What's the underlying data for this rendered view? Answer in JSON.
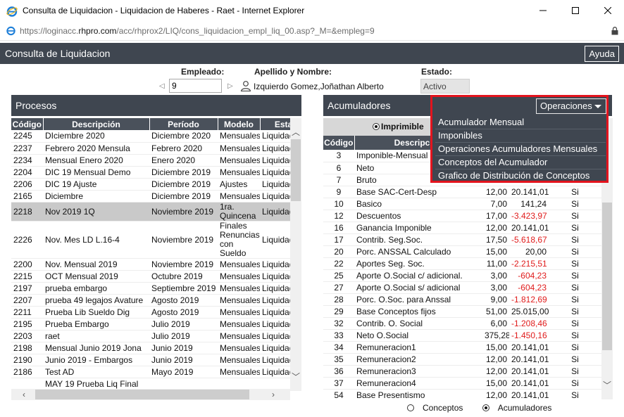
{
  "window": {
    "title": "Consulta de Liquidacion - Liquidacion de Haberes - Raet - Internet Explorer",
    "url_prefix": "https://loginacc.",
    "url_domain": "rhpro.com",
    "url_rest": "/acc/rhprox2/LIQ/cons_liquidacion_empl_liq_00.asp?_M=&empleg=9"
  },
  "app": {
    "title": "Consulta de Liquidacion",
    "help_label": "Ayuda"
  },
  "employee": {
    "label_empleado": "Empleado:",
    "label_nombre": "Apellido y Nombre:",
    "label_estado": "Estado:",
    "legajo": "9",
    "nombre": "Izquierdo Gomez,Joñathan Alberto",
    "estado": "Activo"
  },
  "procesos": {
    "title": "Procesos",
    "columns": [
      "Código",
      "Descripción",
      "Período",
      "Modelo",
      "Esta"
    ],
    "rows": [
      [
        "2245",
        "DIciembre 2020",
        "Diciembre 2020",
        "Mensuales",
        "Liquidad"
      ],
      [
        "2237",
        "Febrero 2020 Mensula",
        "Febrero 2020",
        "Mensuales",
        "Liquidad"
      ],
      [
        "2234",
        "Mensual Enero 2020",
        "Enero 2020",
        "Mensuales",
        "Liquidad"
      ],
      [
        "2204",
        "DIC 19 Mensual Demo",
        "Diciembre 2019",
        "Mensuales",
        "Liquidad"
      ],
      [
        "2206",
        "DIC 19 Ajuste",
        "Diciembre 2019",
        "Ajustes",
        "Liquidad"
      ],
      [
        "2165",
        "Diciembre",
        "Diciembre 2019",
        "Mensuales",
        "Liquidad"
      ],
      [
        "2218",
        "Nov 2019 1Q",
        "Noviembre 2019",
        "1ra. Quincena",
        "Liquidad"
      ],
      [
        "2226",
        "Nov. Mes LD L.16-4",
        "Noviembre 2019",
        "Finales Renuncias con Sueldo",
        "Liquidad"
      ],
      [
        "2200",
        "Nov. Mensual 2019",
        "Noviembre 2019",
        "Mensuales",
        "Liquidad"
      ],
      [
        "2215",
        "OCT Mensual 2019",
        "Octubre 2019",
        "Mensuales",
        "Liquidad"
      ],
      [
        "2197",
        "prueba embargo",
        "Septiembre 2019",
        "Mensuales",
        "Liquidad"
      ],
      [
        "2207",
        "prueba 49 legajos Avature",
        "Agosto 2019",
        "Mensuales",
        "Liquidad"
      ],
      [
        "2211",
        "Prueba Lib Sueldo Dig",
        "Agosto 2019",
        "Mensuales",
        "Liquidad"
      ],
      [
        "2195",
        "Prueba Embargo",
        "Julio 2019",
        "Mensuales",
        "Liquidad"
      ],
      [
        "2203",
        "raet",
        "Julio 2019",
        "Mensuales",
        "Liquidad"
      ],
      [
        "2198",
        "Mensual Junio 2019 Jona",
        "Junio 2019",
        "Mensuales",
        "Liquidad"
      ],
      [
        "2190",
        "Junio 2019 - Embargos",
        "Junio 2019",
        "Mensuales",
        "Liquidad"
      ],
      [
        "2186",
        "Test AD",
        "Mayo 2019",
        "Mensuales",
        "Liquidad"
      ],
      [
        "",
        "MAY 19 Prueba Liq Final",
        "",
        "",
        ""
      ]
    ],
    "selected_index": 6
  },
  "acumuladores": {
    "title": "Acumuladores",
    "imprimible_label": "Imprimible",
    "columns": [
      "Código",
      "Descripción",
      "",
      "",
      ""
    ],
    "rows": [
      [
        "3",
        "Imponible-Mensual",
        "",
        "",
        ""
      ],
      [
        "6",
        "Neto",
        "",
        "",
        ""
      ],
      [
        "7",
        "Bruto",
        "",
        "",
        ""
      ],
      [
        "9",
        "Base SAC-Cert-Desp",
        "12,00",
        "20.141,01",
        "Si"
      ],
      [
        "10",
        "Basico",
        "7,00",
        "141,24",
        "Si"
      ],
      [
        "12",
        "Descuentos",
        "17,00",
        "-3.423,97",
        "Si"
      ],
      [
        "16",
        "Ganancia Imponible",
        "12,00",
        "20.141,01",
        "Si"
      ],
      [
        "17",
        "Contrib. Seg.Soc.",
        "17,50",
        "-5.618,67",
        "Si"
      ],
      [
        "20",
        "Porc. ANSSAL Calculado",
        "15,00",
        "20,00",
        "Si"
      ],
      [
        "22",
        "Aportes Seg. Soc.",
        "11,00",
        "-2.215,51",
        "Si"
      ],
      [
        "25",
        "Aporte O.Social c/ adicional.",
        "3,00",
        "-604,23",
        "Si"
      ],
      [
        "27",
        "Aporte O.Social s/ adicional",
        "3,00",
        "-604,23",
        "Si"
      ],
      [
        "28",
        "Porc. O.Soc. para Anssal",
        "9,00",
        "-1.812,69",
        "Si"
      ],
      [
        "29",
        "Base Conceptos fijos",
        "51,00",
        "25.015,00",
        "Si"
      ],
      [
        "32",
        "Contrib. O. Social",
        "6,00",
        "-1.208,46",
        "Si"
      ],
      [
        "33",
        "Neto O.Social",
        "375,28",
        "-1.450,16",
        "Si"
      ],
      [
        "34",
        "Remuneracion1",
        "15,00",
        "20.141,01",
        "Si"
      ],
      [
        "35",
        "Remuneracion2",
        "12,00",
        "20.141,01",
        "Si"
      ],
      [
        "36",
        "Remuneracion3",
        "12,00",
        "20.141,01",
        "Si"
      ],
      [
        "37",
        "Remuneracion4",
        "15,00",
        "20.141,01",
        "Si"
      ],
      [
        "54",
        "Base Presentismo",
        "12,00",
        "20.141,01",
        "Si"
      ]
    ]
  },
  "operaciones": {
    "button_label": "Operaciones",
    "items": [
      "Acumulador Mensual",
      "Imponibles",
      "Operaciones Acumuladores Mensuales",
      "Conceptos del Acumulador",
      "Grafico de Distribución de Conceptos"
    ]
  },
  "bottom": {
    "conceptos_label": "Conceptos",
    "acumuladores_label": "Acumuladores"
  },
  "colors": {
    "header_dark": "#3f4650",
    "negative": "#e01b1b",
    "highlight_border": "#e3141e"
  }
}
